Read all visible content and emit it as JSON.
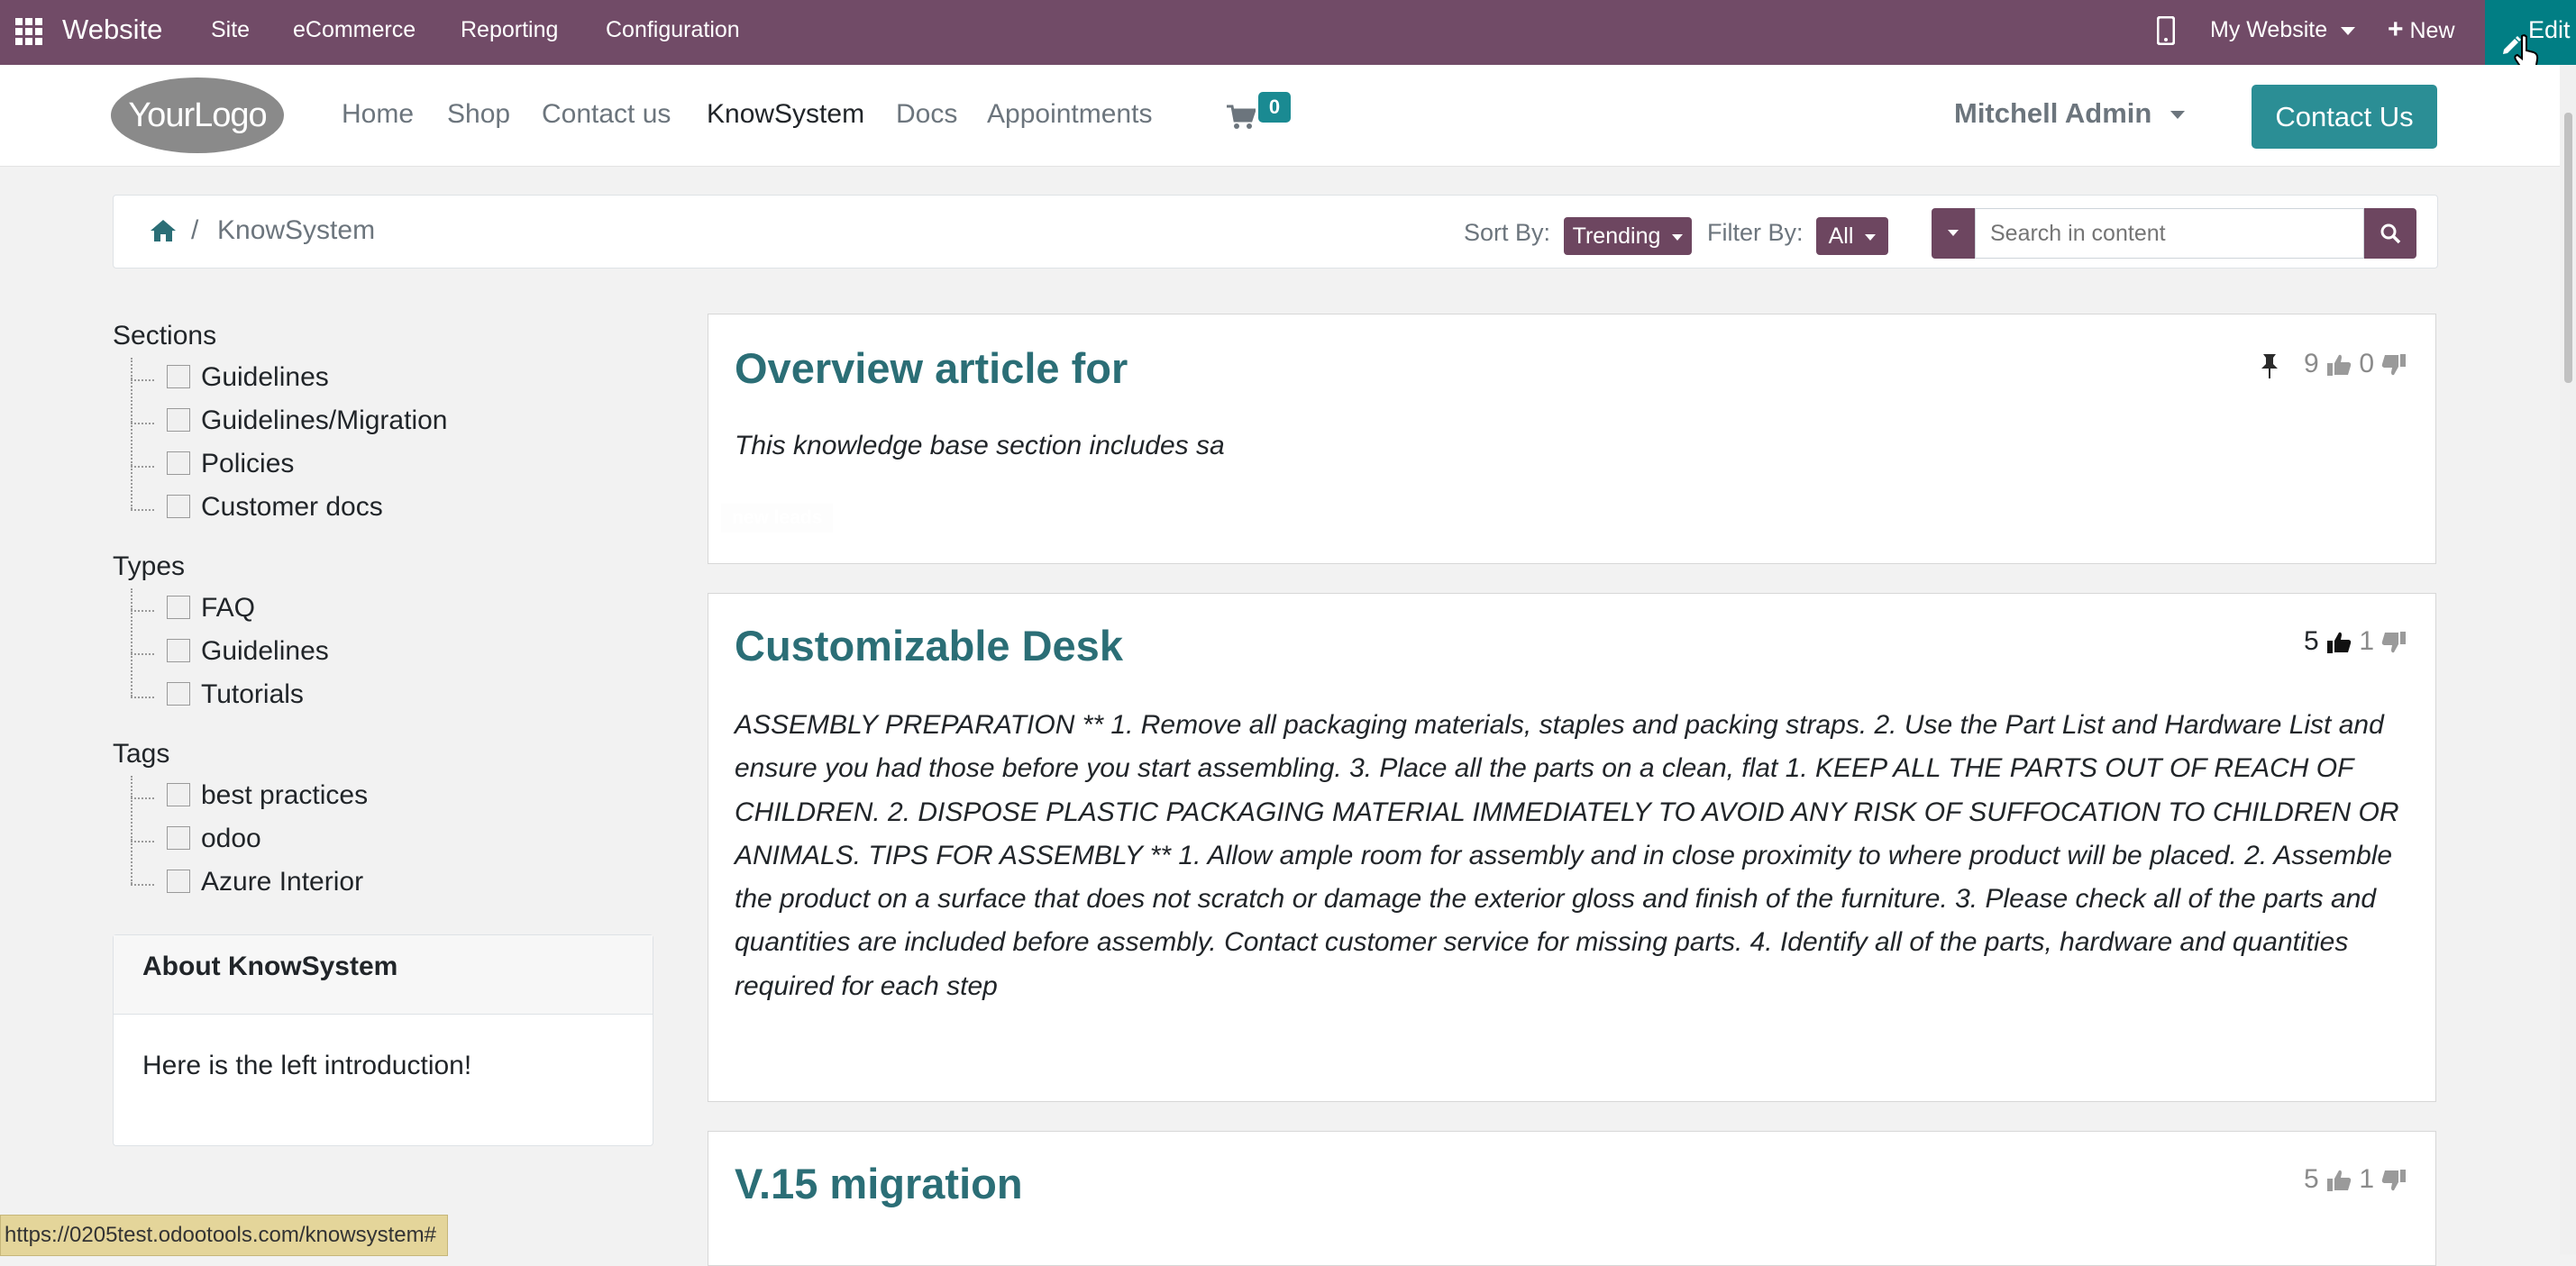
{
  "admin_bar": {
    "brand": "Website",
    "menus": [
      "Site",
      "eCommerce",
      "Reporting",
      "Configuration"
    ],
    "website_selector": "My Website",
    "new_label": "New",
    "edit_label": "Edit",
    "colors": {
      "bar": "#714b67",
      "edit": "#017e84"
    }
  },
  "site_header": {
    "logo_text": "YourLogo",
    "nav": [
      "Home",
      "Shop",
      "Contact us",
      "KnowSystem",
      "Docs",
      "Appointments"
    ],
    "active_nav": "KnowSystem",
    "cart_count": "0",
    "user": "Mitchell Admin",
    "contact_button": "Contact Us"
  },
  "breadcrumb": {
    "current": "KnowSystem",
    "sort_label": "Sort By:",
    "sort_value": "Trending",
    "filter_label": "Filter By:",
    "filter_value": "All",
    "search_placeholder": "Search in content"
  },
  "sidebar": {
    "sections_title": "Sections",
    "sections": [
      "Guidelines",
      "Guidelines/Migration",
      "Policies",
      "Customer docs"
    ],
    "types_title": "Types",
    "types": [
      "FAQ",
      "Guidelines",
      "Tutorials"
    ],
    "tags_title": "Tags",
    "tags": [
      "best practices",
      "odoo",
      "Azure Interior"
    ],
    "about_title": "About KnowSystem",
    "about_text": "Here is the left introduction!"
  },
  "articles": [
    {
      "title": "Overview article for",
      "likes": "9",
      "dislikes": "0",
      "pinned": true,
      "excerpt": "This knowledge base section includes sa",
      "tag": "new leads"
    },
    {
      "title": "Customizable Desk",
      "likes": "5",
      "dislikes": "1",
      "excerpt": "ASSEMBLY PREPARATION ** 1. Remove all packaging materials, staples and packing straps. 2. Use the Part List and Hardware List and ensure you had those before you start assembling. 3. Place all the parts on a clean, flat 1. KEEP ALL THE PARTS OUT OF REACH OF CHILDREN. 2. DISPOSE PLASTIC PACKAGING MATERIAL IMMEDIATELY TO AVOID ANY RISK OF SUFFOCATION TO CHILDREN OR ANIMALS. TIPS FOR ASSEMBLY ** 1. Allow ample room for assembly and in close proximity to where product will be placed. 2. Assemble the product on a surface that does not scratch or damage the exterior gloss and finish of the furniture. 3. Please check all of the parts and quantities are included before assembly. Contact customer service for missing parts. 4. Identify all of the parts, hardware and quantities required for each step"
    },
    {
      "title": "V.15 migration",
      "likes": "5",
      "dislikes": "1"
    }
  ],
  "status_url": "https://0205test.odootools.com/knowsystem#"
}
